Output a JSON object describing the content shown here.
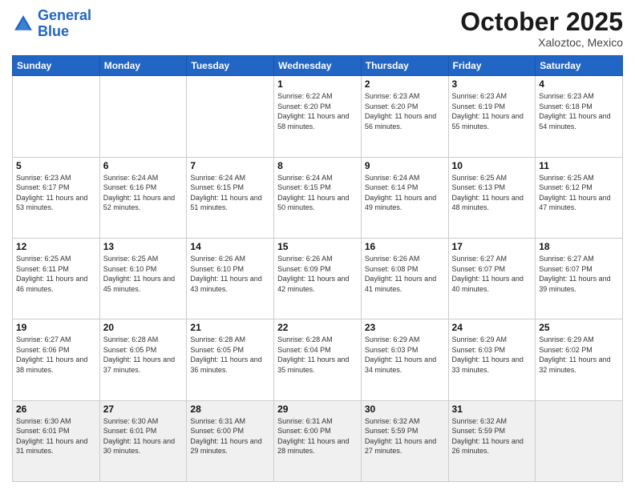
{
  "logo": {
    "line1": "General",
    "line2": "Blue"
  },
  "title": "October 2025",
  "subtitle": "Xaloztoc, Mexico",
  "days_header": [
    "Sunday",
    "Monday",
    "Tuesday",
    "Wednesday",
    "Thursday",
    "Friday",
    "Saturday"
  ],
  "weeks": [
    [
      {
        "day": "",
        "info": ""
      },
      {
        "day": "",
        "info": ""
      },
      {
        "day": "",
        "info": ""
      },
      {
        "day": "1",
        "info": "Sunrise: 6:22 AM\nSunset: 6:20 PM\nDaylight: 11 hours and 58 minutes."
      },
      {
        "day": "2",
        "info": "Sunrise: 6:23 AM\nSunset: 6:20 PM\nDaylight: 11 hours and 56 minutes."
      },
      {
        "day": "3",
        "info": "Sunrise: 6:23 AM\nSunset: 6:19 PM\nDaylight: 11 hours and 55 minutes."
      },
      {
        "day": "4",
        "info": "Sunrise: 6:23 AM\nSunset: 6:18 PM\nDaylight: 11 hours and 54 minutes."
      }
    ],
    [
      {
        "day": "5",
        "info": "Sunrise: 6:23 AM\nSunset: 6:17 PM\nDaylight: 11 hours and 53 minutes."
      },
      {
        "day": "6",
        "info": "Sunrise: 6:24 AM\nSunset: 6:16 PM\nDaylight: 11 hours and 52 minutes."
      },
      {
        "day": "7",
        "info": "Sunrise: 6:24 AM\nSunset: 6:15 PM\nDaylight: 11 hours and 51 minutes."
      },
      {
        "day": "8",
        "info": "Sunrise: 6:24 AM\nSunset: 6:15 PM\nDaylight: 11 hours and 50 minutes."
      },
      {
        "day": "9",
        "info": "Sunrise: 6:24 AM\nSunset: 6:14 PM\nDaylight: 11 hours and 49 minutes."
      },
      {
        "day": "10",
        "info": "Sunrise: 6:25 AM\nSunset: 6:13 PM\nDaylight: 11 hours and 48 minutes."
      },
      {
        "day": "11",
        "info": "Sunrise: 6:25 AM\nSunset: 6:12 PM\nDaylight: 11 hours and 47 minutes."
      }
    ],
    [
      {
        "day": "12",
        "info": "Sunrise: 6:25 AM\nSunset: 6:11 PM\nDaylight: 11 hours and 46 minutes."
      },
      {
        "day": "13",
        "info": "Sunrise: 6:25 AM\nSunset: 6:10 PM\nDaylight: 11 hours and 45 minutes."
      },
      {
        "day": "14",
        "info": "Sunrise: 6:26 AM\nSunset: 6:10 PM\nDaylight: 11 hours and 43 minutes."
      },
      {
        "day": "15",
        "info": "Sunrise: 6:26 AM\nSunset: 6:09 PM\nDaylight: 11 hours and 42 minutes."
      },
      {
        "day": "16",
        "info": "Sunrise: 6:26 AM\nSunset: 6:08 PM\nDaylight: 11 hours and 41 minutes."
      },
      {
        "day": "17",
        "info": "Sunrise: 6:27 AM\nSunset: 6:07 PM\nDaylight: 11 hours and 40 minutes."
      },
      {
        "day": "18",
        "info": "Sunrise: 6:27 AM\nSunset: 6:07 PM\nDaylight: 11 hours and 39 minutes."
      }
    ],
    [
      {
        "day": "19",
        "info": "Sunrise: 6:27 AM\nSunset: 6:06 PM\nDaylight: 11 hours and 38 minutes."
      },
      {
        "day": "20",
        "info": "Sunrise: 6:28 AM\nSunset: 6:05 PM\nDaylight: 11 hours and 37 minutes."
      },
      {
        "day": "21",
        "info": "Sunrise: 6:28 AM\nSunset: 6:05 PM\nDaylight: 11 hours and 36 minutes."
      },
      {
        "day": "22",
        "info": "Sunrise: 6:28 AM\nSunset: 6:04 PM\nDaylight: 11 hours and 35 minutes."
      },
      {
        "day": "23",
        "info": "Sunrise: 6:29 AM\nSunset: 6:03 PM\nDaylight: 11 hours and 34 minutes."
      },
      {
        "day": "24",
        "info": "Sunrise: 6:29 AM\nSunset: 6:03 PM\nDaylight: 11 hours and 33 minutes."
      },
      {
        "day": "25",
        "info": "Sunrise: 6:29 AM\nSunset: 6:02 PM\nDaylight: 11 hours and 32 minutes."
      }
    ],
    [
      {
        "day": "26",
        "info": "Sunrise: 6:30 AM\nSunset: 6:01 PM\nDaylight: 11 hours and 31 minutes."
      },
      {
        "day": "27",
        "info": "Sunrise: 6:30 AM\nSunset: 6:01 PM\nDaylight: 11 hours and 30 minutes."
      },
      {
        "day": "28",
        "info": "Sunrise: 6:31 AM\nSunset: 6:00 PM\nDaylight: 11 hours and 29 minutes."
      },
      {
        "day": "29",
        "info": "Sunrise: 6:31 AM\nSunset: 6:00 PM\nDaylight: 11 hours and 28 minutes."
      },
      {
        "day": "30",
        "info": "Sunrise: 6:32 AM\nSunset: 5:59 PM\nDaylight: 11 hours and 27 minutes."
      },
      {
        "day": "31",
        "info": "Sunrise: 6:32 AM\nSunset: 5:59 PM\nDaylight: 11 hours and 26 minutes."
      },
      {
        "day": "",
        "info": ""
      }
    ]
  ]
}
